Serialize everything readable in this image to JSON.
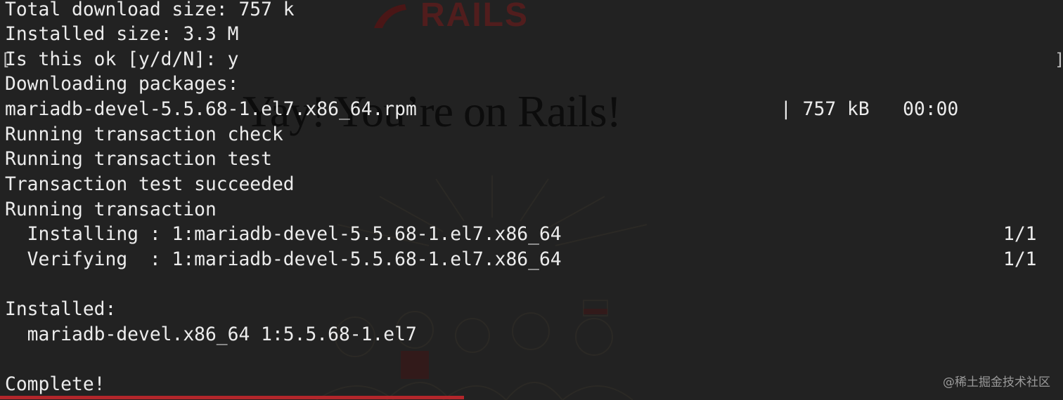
{
  "background": {
    "logo_text": "RAILS",
    "heading": "Yay! You’re on Rails!"
  },
  "terminal": {
    "lines": [
      "Total download size: 757 k",
      "Installed size: 3.3 M",
      "Is this ok [y/d/N]: y",
      "Downloading packages:",
      "mariadb-devel-5.5.68-1.el7.x86_64.rpm",
      "Running transaction check",
      "Running transaction test",
      "Transaction test succeeded",
      "Running transaction",
      "  Installing : 1:mariadb-devel-5.5.68-1.el7.x86_64",
      "  Verifying  : 1:mariadb-devel-5.5.68-1.el7.x86_64",
      "",
      "Installed:",
      "  mariadb-devel.x86_64 1:5.5.68-1.el7",
      "",
      "Complete!"
    ],
    "download_progress": "| 757 kB   00:00",
    "installing_count": "1/1",
    "verifying_count": "1/1"
  },
  "watermark": "@稀土掘金技术社区",
  "colors": {
    "terminal_bg": "#222222",
    "text": "#ececec",
    "accent_red": "#b3262b"
  }
}
